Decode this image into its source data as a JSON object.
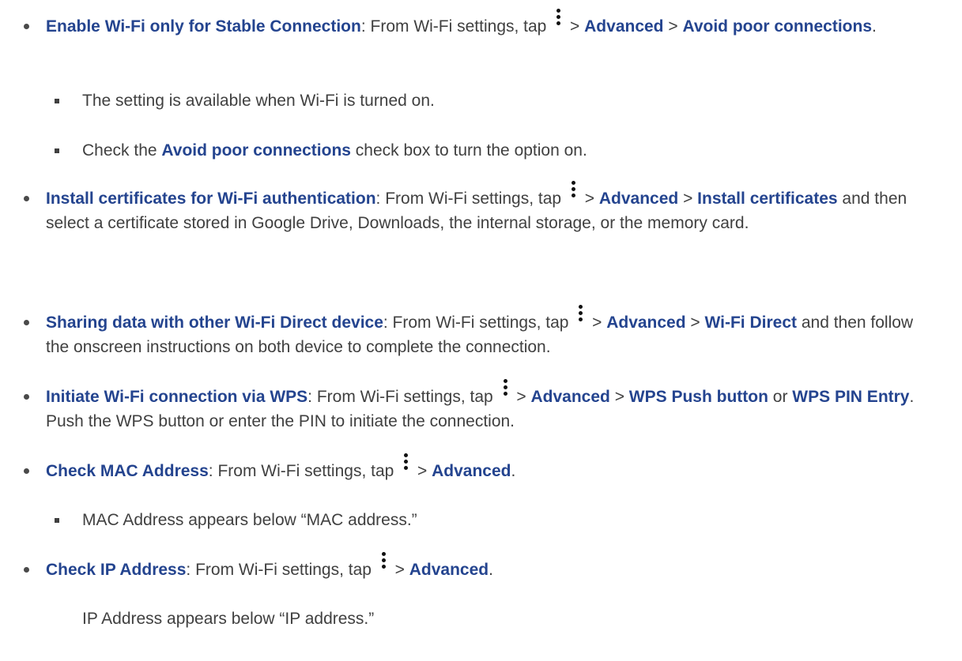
{
  "items": [
    {
      "title": "Enable Wi-Fi only for Stable Connection",
      "pre": ": From Wi-Fi settings, tap ",
      "gt1": " > ",
      "b1": "Advanced",
      "gt2": " > ",
      "b2": "Avoid poor connections",
      "end": ".",
      "subitems": [
        {
          "text": "The setting is available when Wi-Fi is turned on."
        },
        {
          "pre": "Check the ",
          "bold": "Avoid poor connections",
          "post": " check box to turn the option on."
        }
      ]
    },
    {
      "title": "Install certificates for Wi-Fi authentication",
      "pre": ": From Wi-Fi settings, tap ",
      "gt1": " > ",
      "b1": "Advanced",
      "gt2": " > ",
      "b2": "Install certificates",
      "end": " and then select a certificate stored in Google Drive, Downloads, the internal storage, or the memory card."
    },
    {
      "title": "Sharing data with other Wi-Fi Direct device",
      "pre": ": From Wi-Fi settings, tap ",
      "gt1": " > ",
      "b1": "Advanced",
      "gt2": " > ",
      "b2": "Wi-Fi Direct",
      "end": " and then follow the onscreen instructions on both device to complete the connection."
    },
    {
      "title": "Initiate Wi-Fi connection via WPS",
      "pre": ": From Wi-Fi settings, tap ",
      "gt1": " > ",
      "b1": "Advanced",
      "gt2": " > ",
      "b2": "WPS Push button",
      "or": " or ",
      "b3": "WPS PIN Entry",
      "end": ". Push the WPS button or enter the PIN to initiate the connection."
    },
    {
      "title": "Check MAC Address",
      "pre": ": From Wi-Fi settings, tap ",
      "gt1": " > ",
      "b1": "Advanced",
      "end": ".",
      "subitems": [
        {
          "text": "MAC Address appears below “MAC address.”"
        }
      ]
    },
    {
      "title": "Check IP Address",
      "pre": ": From Wi-Fi settings, tap ",
      "gt1": " > ",
      "b1": "Advanced",
      "end": ".",
      "note": "IP Address appears below “IP address.”"
    }
  ],
  "icon": "more-vert-icon"
}
